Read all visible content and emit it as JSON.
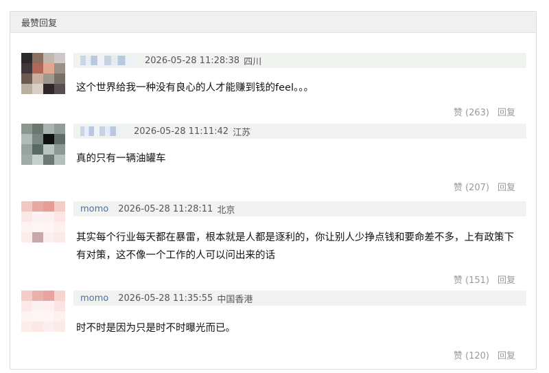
{
  "section_title": "最赞回复",
  "comments": [
    {
      "nickname": "",
      "time": "2026-05-28 11:28:38",
      "location": "四川",
      "text": "这个世界给我一种没有良心的人才能赚到钱的feel。。。",
      "like_label": "赞 (263)",
      "reply_label": "回复",
      "avatar_colors": [
        "#2a2a2a",
        "#8a7060",
        "#c0b8b0",
        "#d0c8c8",
        "#403838",
        "#b06858",
        "#e0a890",
        "#9a9088",
        "#6a5a50",
        "#c8b0a0",
        "#a09890",
        "#787068",
        "#b8b0a0",
        "#d8d0c8",
        "#302828",
        "#585050"
      ]
    },
    {
      "nickname": "",
      "time": "2026-05-28 11:11:42",
      "location": "江苏",
      "text": "真的只有一辆油罐车",
      "like_label": "赞 (207)",
      "reply_label": "回复",
      "avatar_colors": [
        "#8a9890",
        "#6a7870",
        "#a8b4b0",
        "#909c98",
        "#b0bcb8",
        "#7a8884",
        "#101010",
        "#606c68",
        "#98a4a0",
        "#5a6864",
        "#b8c4c0",
        "#8c9894",
        "#a0aca8",
        "#c4d0cc",
        "#6c7874",
        "#b4c0bc"
      ]
    },
    {
      "nickname": "momo",
      "time": "2026-05-28 11:28:11",
      "location": "北京",
      "text": "其实每个行业每天都在暴雷，根本就是人都是逐利的，你让别人少挣点钱和要命差不多，上有政策下有对策，这不像一个工作的人可以问出来的话",
      "like_label": "赞 (151)",
      "reply_label": "回复",
      "avatar_colors": [
        "#f2c8c4",
        "#e8a8a4",
        "#e89c98",
        "#f4ccc8",
        "#fbe8e6",
        "#fdf2f1",
        "#fdf0ef",
        "#fbe6e4",
        "#fdf3f2",
        "#fef6f5",
        "#fef5f4",
        "#fdf0ee",
        "#fcecea",
        "#c8a8a8",
        "#fcefee",
        "#fbeae8"
      ]
    },
    {
      "nickname": "momo",
      "time": "2026-05-28 11:35:55",
      "location": "中国香港",
      "text": "时不时是因为只是时不时曝光而已。",
      "like_label": "赞 (120)",
      "reply_label": "回复",
      "avatar_colors": [
        "#f4ccc8",
        "#eab0ac",
        "#e8a4a0",
        "#f6d4d0",
        "#fce9e7",
        "#fdf1f0",
        "#fdf0ef",
        "#fae3e1",
        "#fdf3f2",
        "#fef6f5",
        "#fef5f4",
        "#fdf0ee",
        "#fcecea",
        "#fbe8e6",
        "#fcefee",
        "#fbeae8"
      ]
    }
  ]
}
